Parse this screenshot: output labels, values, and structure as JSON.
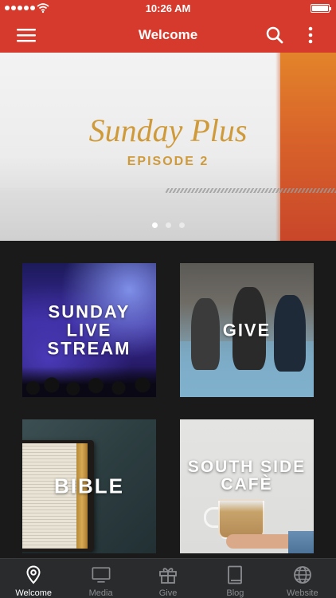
{
  "status_bar": {
    "time": "10:26 AM"
  },
  "nav": {
    "title": "Welcome"
  },
  "hero": {
    "title": "Sunday Plus",
    "subtitle": "EPISODE 2",
    "slide_count": 3,
    "active_slide": 1,
    "accent_color": "#cf9a3a"
  },
  "tiles": [
    {
      "label": "SUNDAY LIVE STREAM"
    },
    {
      "label": "GIVE"
    },
    {
      "label": "BIBLE"
    },
    {
      "label": "SOUTH SIDE CAFÈ"
    }
  ],
  "tab_bar": {
    "active_tab": "Welcome",
    "tabs": [
      {
        "label": "Welcome",
        "icon": "location-pin-icon"
      },
      {
        "label": "Media",
        "icon": "monitor-icon"
      },
      {
        "label": "Give",
        "icon": "gift-icon"
      },
      {
        "label": "Blog",
        "icon": "book-icon"
      },
      {
        "label": "Website",
        "icon": "globe-icon"
      }
    ]
  },
  "colors": {
    "brand": "#d53a2c",
    "background": "#1a1a1b",
    "tab_bar": "#2a2b2d",
    "tab_active": "#ffffff",
    "tab_inactive": "#8a8c90"
  }
}
